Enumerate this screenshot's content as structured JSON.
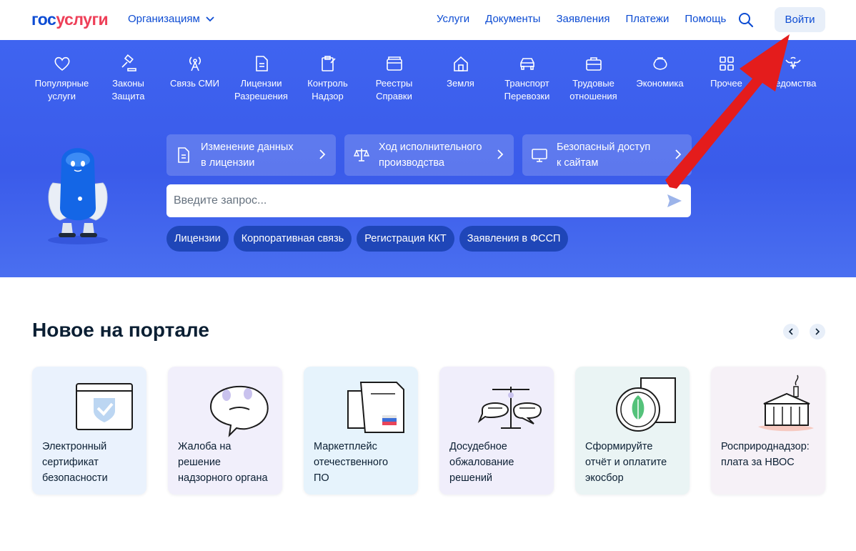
{
  "header": {
    "logo_gos": "гос",
    "logo_usl": "услуги",
    "org_label": "Организациям",
    "nav": [
      "Услуги",
      "Документы",
      "Заявления",
      "Платежи",
      "Помощь"
    ],
    "login": "Войти"
  },
  "categories": [
    {
      "label": "Популярные\nуслуги",
      "icon": "heart-icon"
    },
    {
      "label": "Законы\nЗащита",
      "icon": "gavel-icon"
    },
    {
      "label": "Связь СМИ",
      "icon": "antenna-icon"
    },
    {
      "label": "Лицензии\nРазрешения",
      "icon": "document-icon"
    },
    {
      "label": "Контроль\nНадзор",
      "icon": "clipboard-icon"
    },
    {
      "label": "Реестры\nСправки",
      "icon": "folder-icon"
    },
    {
      "label": "Земля",
      "icon": "house-icon"
    },
    {
      "label": "Транспорт\nПеревозки",
      "icon": "car-icon"
    },
    {
      "label": "Трудовые\nотношения",
      "icon": "briefcase-icon"
    },
    {
      "label": "Экономика",
      "icon": "coins-icon"
    },
    {
      "label": "Прочее",
      "icon": "grid-icon"
    },
    {
      "label": "Ведомства",
      "icon": "eagle-icon"
    }
  ],
  "quick_links": [
    {
      "label": "Изменение данных\nв лицензии",
      "icon": "document-icon"
    },
    {
      "label": "Ход исполнительного\nпроизводства",
      "icon": "scales-icon"
    },
    {
      "label": "Безопасный доступ\nк сайтам",
      "icon": "monitor-icon"
    }
  ],
  "search": {
    "placeholder": "Введите запрос..."
  },
  "chips": [
    "Лицензии",
    "Корпоративная связь",
    "Регистрация ККТ",
    "Заявления в ФССП"
  ],
  "news": {
    "title": "Новое на портале",
    "cards": [
      {
        "label": "Электронный\nсертификат\nбезопасности",
        "icon": "certificate-icon",
        "bg": "#eaf2fd"
      },
      {
        "label": "Жалоба на\nрешение\nнадзорного органа",
        "icon": "complaint-bubble-icon",
        "bg": "#f1effb"
      },
      {
        "label": "Маркетплейс\nотечественного\nПО",
        "icon": "folders-icon",
        "bg": "#e6f3fc"
      },
      {
        "label": "Досудебное\nобжалование\nрешений",
        "icon": "scales-bubbles-icon",
        "bg": "#f0eefb"
      },
      {
        "label": "Сформируйте\nотчёт и оплатите\nэкосбор",
        "icon": "eco-coin-icon",
        "bg": "#eaf4f4"
      },
      {
        "label": "Росприроднадзор:\nплата за НВОС",
        "icon": "factory-icon",
        "bg": "#f6f1f7"
      }
    ]
  },
  "colors": {
    "brand_blue": "#0d4cd3",
    "brand_red": "#ee3f58",
    "banner": "#3f64f0",
    "chip": "#1f46b8",
    "annotation_arrow": "#e41c1c"
  }
}
